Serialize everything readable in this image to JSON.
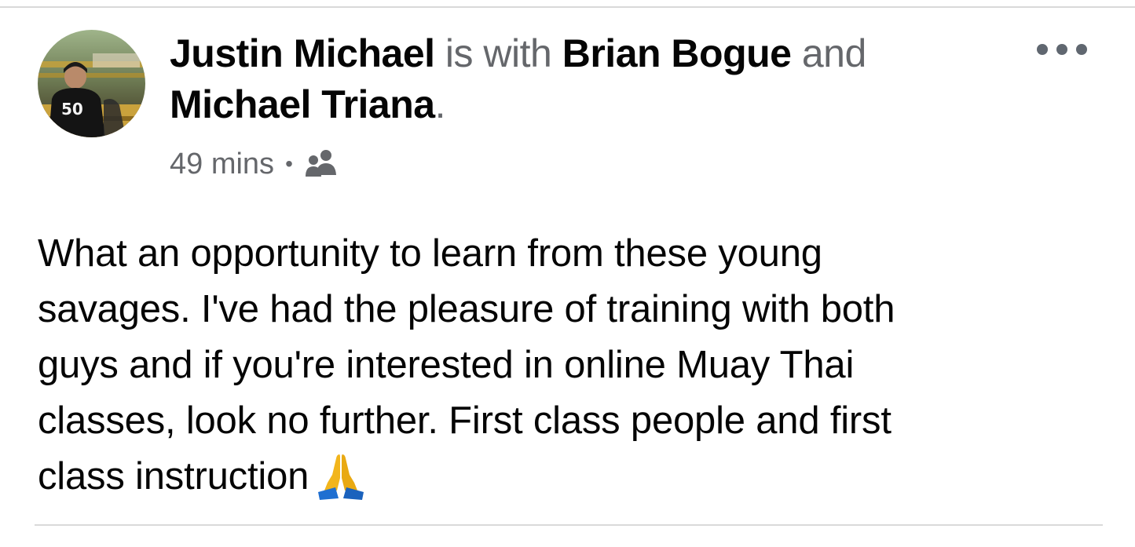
{
  "post": {
    "author": "Justin Michael",
    "connector_with": " is with ",
    "tagged": [
      "Brian Bogue",
      "Michael Triana"
    ],
    "connector_and": " and ",
    "end_period": ".",
    "avatar_badge": "50",
    "timestamp": "49 mins",
    "separator": "•",
    "audience_icon": "friends-icon",
    "more_icon": "more-options-icon",
    "body": [
      "What an opportunity to learn from these young",
      "savages. I've had the pleasure of training with both",
      "guys and if you're interested in online Muay Thai",
      "classes, look no further. First class people and first",
      "class instruction"
    ],
    "emoji": "folded-hands-emoji"
  },
  "colors": {
    "name_text": "#050505",
    "secondary_text": "#65676b",
    "divider": "#d9d9d9",
    "icon_gray": "#606770"
  }
}
